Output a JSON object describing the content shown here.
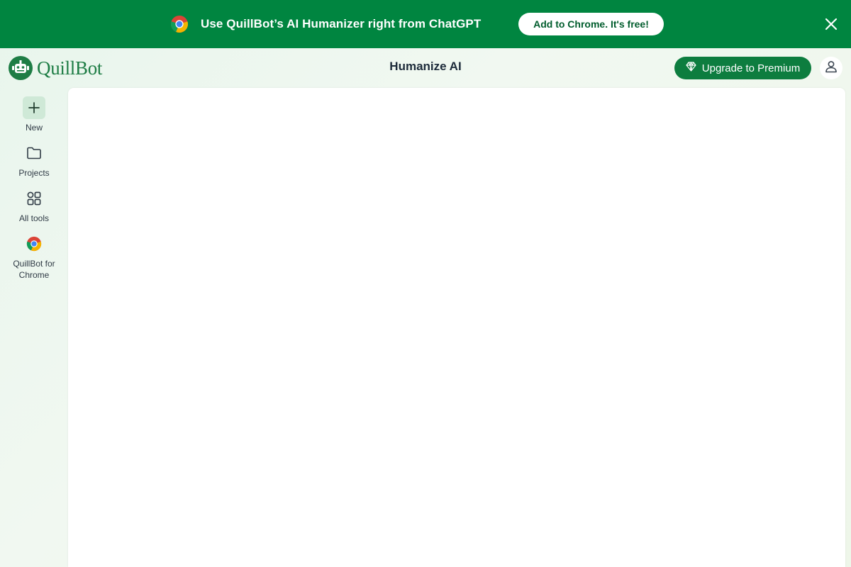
{
  "banner": {
    "message": "Use QuillBot’s AI Humanizer right from ChatGPT",
    "cta_label": "Add to Chrome. It's free!",
    "icons": {
      "browser": "chrome-icon",
      "close": "close-icon"
    },
    "background_color": "#008540"
  },
  "header": {
    "logo_text": "QuillBot",
    "title": "Humanize AI",
    "premium_label": "Upgrade to Premium",
    "icons": {
      "premium": "diamond-icon",
      "account": "user-icon"
    },
    "accent_color": "#0d7d3f"
  },
  "sidebar": {
    "items": [
      {
        "label": "New",
        "icon": "plus-icon"
      },
      {
        "label": "Projects",
        "icon": "folder-icon"
      },
      {
        "label": "All tools",
        "icon": "grid-icon"
      },
      {
        "label": "QuillBot for Chrome",
        "icon": "chrome-icon"
      }
    ]
  }
}
